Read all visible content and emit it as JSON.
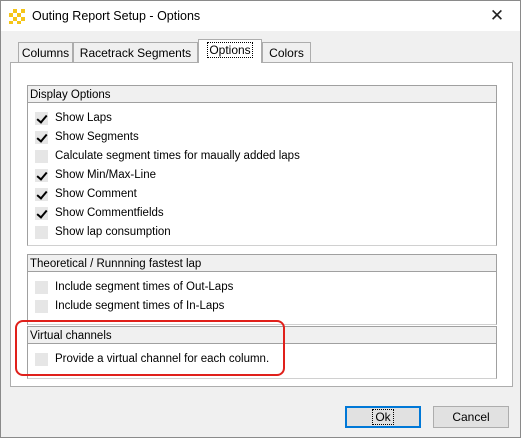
{
  "window": {
    "title": "Outing Report Setup - Options",
    "close_glyph": "✕"
  },
  "tabs": [
    {
      "label": "Columns",
      "active": false
    },
    {
      "label": "Racetrack Segments",
      "active": false
    },
    {
      "label": "Options",
      "active": true
    },
    {
      "label": "Colors",
      "active": false
    }
  ],
  "groups": {
    "display": {
      "title": "Display Options",
      "items": [
        {
          "label": "Show Laps",
          "checked": true
        },
        {
          "label": "Show Segments",
          "checked": true
        },
        {
          "label": "Calculate segment times for maually added laps",
          "checked": false
        },
        {
          "label": "Show Min/Max-Line",
          "checked": true
        },
        {
          "label": "Show Comment",
          "checked": true
        },
        {
          "label": "Show Commentfields",
          "checked": true
        },
        {
          "label": "Show lap consumption",
          "checked": false
        }
      ]
    },
    "fastest": {
      "title": "Theoretical / Runnning fastest lap",
      "items": [
        {
          "label": "Include segment times of Out-Laps",
          "checked": false
        },
        {
          "label": "Include segment times of In-Laps",
          "checked": false
        }
      ]
    },
    "virtual": {
      "title": "Virtual channels",
      "items": [
        {
          "label": "Provide a virtual channel for each column.",
          "checked": false
        }
      ]
    }
  },
  "buttons": {
    "ok": "Ok",
    "cancel": "Cancel"
  },
  "highlight_color": "#e0201b",
  "icons": {
    "app": "app-report-icon",
    "close": "close-icon"
  }
}
